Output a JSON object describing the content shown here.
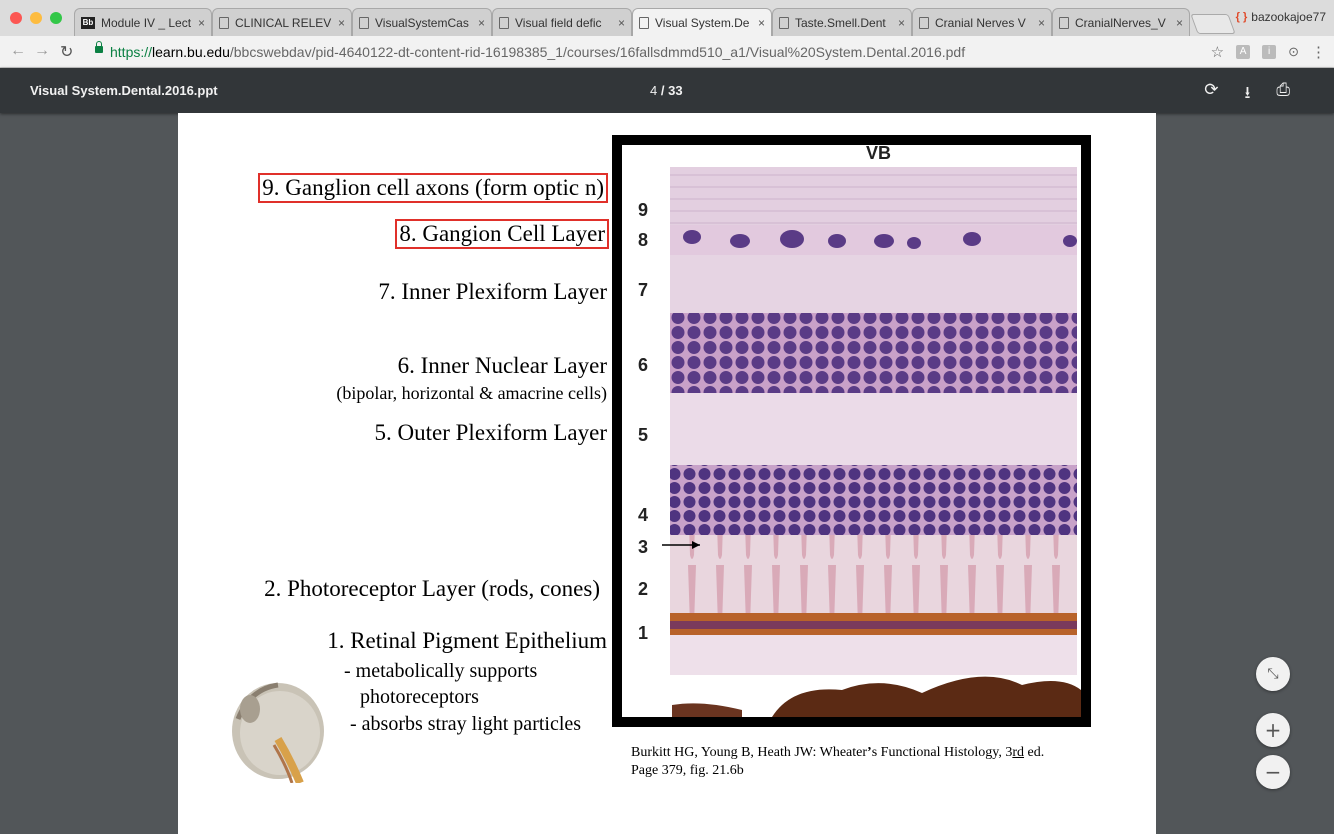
{
  "browser": {
    "tabs": [
      {
        "icon": "blackboard-icon",
        "label": "Module IV _ Lect"
      },
      {
        "icon": "document-icon",
        "label": "CLINICAL RELEV"
      },
      {
        "icon": "document-icon",
        "label": "VisualSystemCas"
      },
      {
        "icon": "document-icon",
        "label": "Visual field defic"
      },
      {
        "icon": "document-icon",
        "label": "Visual System.De",
        "active": true
      },
      {
        "icon": "document-icon",
        "label": "Taste.Smell.Dent"
      },
      {
        "icon": "document-icon",
        "label": "Cranial Nerves V"
      },
      {
        "icon": "document-icon",
        "label": "CranialNerves_V"
      }
    ],
    "close_glyph": "×",
    "profile": "bazookajoe77",
    "url": {
      "protocol": "https://",
      "host": "learn.bu.edu",
      "path": "/bbcswebdav/pid-4640122-dt-content-rid-16198385_1/courses/16fallsdmmd510_a1/Visual%20System.Dental.2016.pdf"
    }
  },
  "viewer": {
    "title": "Visual System.Dental.2016.ppt",
    "current_page": "4",
    "separator": "/",
    "total_pages": "33"
  },
  "slide": {
    "labels": {
      "l9": "9. Ganglion cell axons (form optic n)",
      "l8": "8. Gangion Cell Layer",
      "l7": "7. Inner Plexiform Layer",
      "l6": "6. Inner Nuclear Layer",
      "l6_sub": "(bipolar, horizontal & amacrine cells)",
      "l5": "5. Outer Plexiform Layer",
      "l2": "2. Photoreceptor Layer (rods, cones)",
      "l1": "1. Retinal Pigment Epithelium",
      "l1_b1": "- metabolically supports",
      "l1_b1b": "photoreceptors",
      "l1_b2": "- absorbs stray light particles"
    },
    "micrograph": {
      "tag": "VB",
      "layer_numbers": [
        "9",
        "8",
        "7",
        "6",
        "5",
        "4",
        "3",
        "2",
        "1"
      ]
    },
    "caption": {
      "line1_a": "Burkitt HG, Young B, Heath JW: Wheater",
      "line1_quote": "’",
      "line1_b": "s Functional Histology, 3",
      "line1_ord": "rd",
      "line1_c": " ed.",
      "line2": "Page 379, fig. 21.6b"
    }
  },
  "zoom": {
    "fit": "⤡",
    "in": "+",
    "out": "−"
  }
}
